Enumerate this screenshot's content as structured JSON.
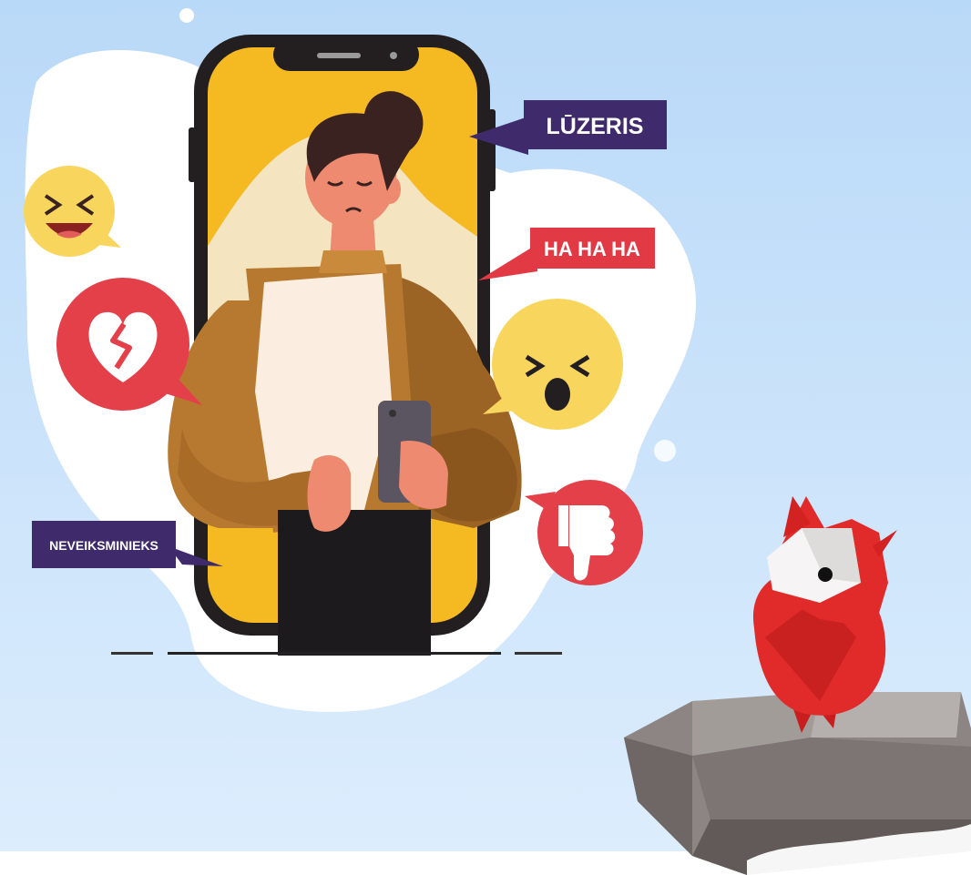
{
  "illustration": {
    "colors": {
      "background_top": "#b9d9f8",
      "background_bottom": "#d9ebfc",
      "blob": "#ffffff",
      "phone_frame": "#231f20",
      "phone_screen": "#f5b921",
      "screen_hill": "#f4e4bf",
      "label_purple": "#3f2a6b",
      "label_red": "#e13a45",
      "emoji_yellow": "#f8d55d",
      "bubble_red": "#e4404a",
      "jacket": "#b7792f",
      "shirt": "#fbeee0",
      "skin": "#ee8a6f",
      "hair": "#3a2220",
      "pants": "#1c1a1c",
      "owl_red": "#e12b2b",
      "rock_gray": "#8c8583"
    },
    "labels": {
      "luzeris": "LŪZERIS",
      "ha_ha_ha": "HA HA HA",
      "neveiksminieks": "NEVEIKSMINIEKS"
    },
    "icons": [
      "laughing-emoji-icon",
      "broken-heart-icon",
      "shouting-emoji-icon",
      "thumbs-down-icon"
    ]
  }
}
